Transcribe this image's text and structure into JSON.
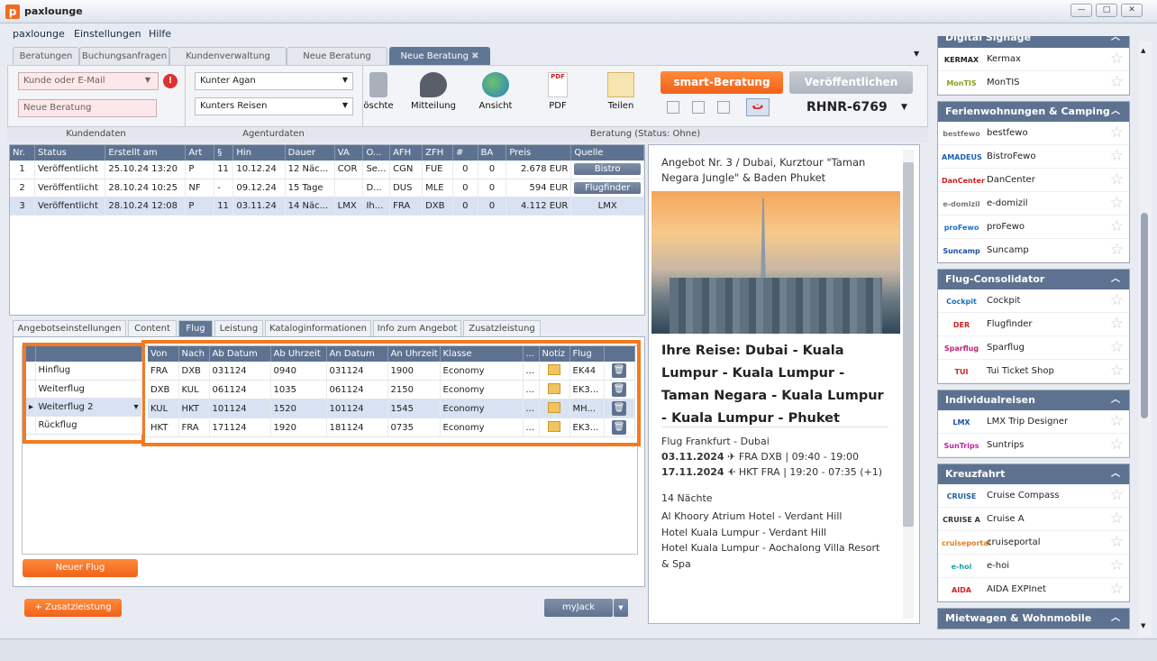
{
  "app": {
    "title": "paxlounge",
    "logo": "p"
  },
  "menu": [
    "paxlounge",
    "Einstellungen",
    "Hilfe"
  ],
  "tabs": [
    "Beratungen",
    "Buchungsanfragen",
    "Kundenverwaltung",
    "Neue Beratung",
    "Neue Beratung"
  ],
  "kundendaten": {
    "customer_placeholder": "Kunde oder E-Mail",
    "consultation": "Neue Beratung",
    "label": "Kundendaten"
  },
  "agenturdaten": {
    "agent": "Kunter Agan",
    "agency": "Kunters Reisen",
    "label": "Agenturdaten"
  },
  "tools": {
    "loeschen": "öschte",
    "mitteilung": "Mitteilung",
    "ansicht": "Ansicht",
    "pdf": "PDF",
    "teilen": "Teilen",
    "pdf_badge": "PDF"
  },
  "beratung": {
    "smart_button": "smart-Beratung",
    "publish_button": "Veröffentlichen",
    "rhnr": "RHNR-6769",
    "status": "Beratung (Status: Ohne)"
  },
  "offers": {
    "headers": [
      "Nr.",
      "Status",
      "Erstellt am",
      "Art",
      "§",
      "Hin",
      "Dauer",
      "VA",
      "O...",
      "AFH",
      "ZFH",
      "#",
      "BA",
      "Preis",
      "Quelle"
    ],
    "rows": [
      [
        "1",
        "Veröffentlicht",
        "25.10.24 13:20",
        "P",
        "11",
        "10.12.24",
        "12 Näc...",
        "COR",
        "Se...",
        "CGN",
        "FUE",
        "0",
        "0",
        "2.678 EUR",
        "Bistro"
      ],
      [
        "2",
        "Veröffentlicht",
        "28.10.24 10:25",
        "NF",
        "-",
        "09.12.24",
        "15 Tage",
        "",
        "D...",
        "DUS",
        "MLE",
        "0",
        "0",
        "594 EUR",
        "Flugfinder"
      ],
      [
        "3",
        "Veröffentlicht",
        "28.10.24 12:08",
        "P",
        "11",
        "03.11.24",
        "14 Näc...",
        "LMX",
        "Ih...",
        "FRA",
        "DXB",
        "0",
        "0",
        "4.112 EUR",
        "LMX"
      ]
    ]
  },
  "subtabs": [
    "Angebotseinstellungen",
    "Content",
    "Flug",
    "Leistung",
    "Kataloginformationen",
    "Info zum Angebot",
    "Zusatzleistung"
  ],
  "flights": {
    "headers": [
      "Von",
      "Nach",
      "Ab Datum",
      "Ab Uhrzeit",
      "An Datum",
      "An Uhrzeit",
      "Klasse",
      "...",
      "Notiz",
      "Flug"
    ],
    "legs": [
      "Hinflug",
      "Weiterflug",
      "Weiterflug 2",
      "Rückflug"
    ],
    "rows": [
      [
        "FRA",
        "DXB",
        "031124",
        "0940",
        "031124",
        "1900",
        "Economy",
        "...",
        "",
        "EK44"
      ],
      [
        "DXB",
        "KUL",
        "061124",
        "1035",
        "061124",
        "2150",
        "Economy",
        "...",
        "",
        "EK3..."
      ],
      [
        "KUL",
        "HKT",
        "101124",
        "1520",
        "101124",
        "1545",
        "Economy",
        "...",
        "",
        "MH..."
      ],
      [
        "HKT",
        "FRA",
        "171124",
        "1920",
        "181124",
        "0735",
        "Economy",
        "...",
        "",
        "EK3..."
      ]
    ],
    "new_flight": "Neuer Flug",
    "zusatz": "+ Zusatzleistung",
    "myjack": "myJack"
  },
  "preview": {
    "offer": "Angebot Nr. 3 / Dubai, Kurztour \"Taman Negara Jungle\" & Baden Phuket",
    "headline": "Ihre Reise: Dubai - Kuala Lumpur - Kuala Lumpur - Taman Negara - Kuala Lumpur - Kuala Lumpur - Phuket",
    "flight_label": "Flug Frankfurt - Dubai",
    "out_date": "03.11.2024",
    "out_route": "FRA DXB | 09:40 - 19:00",
    "ret_date": "17.11.2024",
    "ret_route": "HKT FRA | 19:20 - 07:35 (+1)",
    "nights": "14 Nächte",
    "hotels": [
      "Al Khoory Atrium Hotel - Verdant Hill",
      "Hotel Kuala Lumpur - Verdant Hill",
      "Hotel Kuala Lumpur - Aochalong Villa Resort & Spa"
    ]
  },
  "sidebar": [
    {
      "title": "Digital Signage",
      "items": [
        {
          "logo": "KERMAX",
          "name": "Kermax",
          "color": "#222"
        },
        {
          "logo": "MonTIS",
          "name": "MonTIS",
          "color": "#8aa020"
        }
      ]
    },
    {
      "title": "Ferienwohnungen & Camping",
      "items": [
        {
          "logo": "bestfewo",
          "name": "bestfewo",
          "color": "#777"
        },
        {
          "logo": "AMADEUS",
          "name": "BistroFewo",
          "color": "#1a5fb4"
        },
        {
          "logo": "DanCenter",
          "name": "DanCenter",
          "color": "#d02020"
        },
        {
          "logo": "e-domizil",
          "name": "e-domizil",
          "color": "#777"
        },
        {
          "logo": "proFewo",
          "name": "proFewo",
          "color": "#1a70c0"
        },
        {
          "logo": "Suncamp",
          "name": "Suncamp",
          "color": "#2050a0"
        }
      ]
    },
    {
      "title": "Flug-Consolidator",
      "items": [
        {
          "logo": "Cockpit",
          "name": "Cockpit",
          "color": "#1a70c0"
        },
        {
          "logo": "DER",
          "name": "Flugfinder",
          "color": "#d02020"
        },
        {
          "logo": "Sparflug",
          "name": "Sparflug",
          "color": "#c0207a"
        },
        {
          "logo": "TUI",
          "name": "Tui Ticket Shop",
          "color": "#d02020"
        }
      ]
    },
    {
      "title": "Individualreisen",
      "items": [
        {
          "logo": "LMX",
          "name": "LMX Trip Designer",
          "color": "#1a50a0"
        },
        {
          "logo": "SunTrips",
          "name": "Suntrips",
          "color": "#c020a0"
        }
      ]
    },
    {
      "title": "Kreuzfahrt",
      "items": [
        {
          "logo": "CRUISE",
          "name": "Cruise Compass",
          "color": "#2060a0"
        },
        {
          "logo": "CRUISE A",
          "name": "Cruise A",
          "color": "#333"
        },
        {
          "logo": "cruiseportal",
          "name": "cruiseportal",
          "color": "#e08020"
        },
        {
          "logo": "e-hoi",
          "name": "e-hoi",
          "color": "#20a0a0"
        },
        {
          "logo": "AIDA",
          "name": "AIDA EXPInet",
          "color": "#d02020"
        }
      ]
    },
    {
      "title": "Mietwagen & Wohnmobile",
      "items": []
    }
  ]
}
